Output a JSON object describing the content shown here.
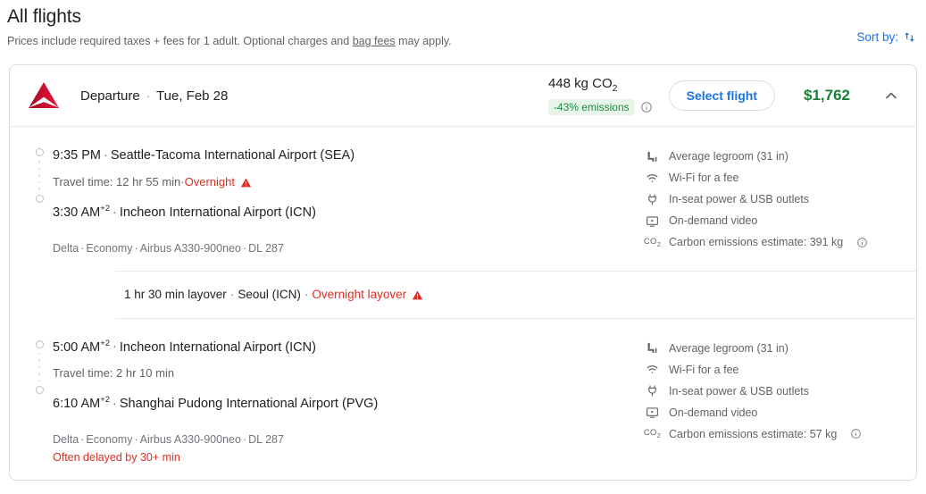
{
  "header": {
    "title": "All flights",
    "subtitle_pre": "Prices include required taxes + fees for 1 adult. Optional charges and ",
    "subtitle_link": "bag fees",
    "subtitle_post": " may apply.",
    "sort_label": "Sort by:"
  },
  "flight": {
    "airline_logo": "delta-logo",
    "direction_label": "Departure",
    "separator": "·",
    "date": "Tue, Feb 28",
    "emissions_total": "448 kg CO",
    "emissions_total_sub": "2",
    "emissions_badge": "-43% emissions",
    "select_button": "Select flight",
    "price": "$1,762",
    "collapse_icon": "chevron-up-icon",
    "info_icon": "info-icon"
  },
  "legs": [
    {
      "depart_time": "9:35 PM",
      "depart_sup": "",
      "depart_airport": "Seattle-Tacoma International Airport (SEA)",
      "travel_time": "Travel time: 12 hr 55 min",
      "travel_separator": " · ",
      "warning": "Overnight",
      "warning_icon": "warning-triangle-icon",
      "arrive_time": "3:30 AM",
      "arrive_sup": "+2",
      "arrive_airport": "Incheon International Airport (ICN)",
      "meta": [
        "Delta",
        "Economy",
        "Airbus A330-900neo",
        "DL 287"
      ],
      "delay_note": "",
      "amenities": [
        {
          "icon": "legroom-icon",
          "text": "Average legroom (31 in)",
          "info": false
        },
        {
          "icon": "wifi-icon",
          "text": "Wi-Fi for a fee",
          "info": false
        },
        {
          "icon": "power-plug-icon",
          "text": "In-seat power & USB outlets",
          "info": false
        },
        {
          "icon": "video-icon",
          "text": "On-demand video",
          "info": false
        },
        {
          "icon": "co2-icon",
          "text": "Carbon emissions estimate: 391 kg",
          "info": true
        }
      ]
    },
    {
      "depart_time": "5:00 AM",
      "depart_sup": "+2",
      "depart_airport": "Incheon International Airport (ICN)",
      "travel_time": "Travel time: 2 hr 10 min",
      "travel_separator": "",
      "warning": "",
      "warning_icon": "",
      "arrive_time": "6:10 AM",
      "arrive_sup": "+2",
      "arrive_airport": "Shanghai Pudong International Airport (PVG)",
      "meta": [
        "Delta",
        "Economy",
        "Airbus A330-900neo",
        "DL 287"
      ],
      "delay_note": "Often delayed by 30+ min",
      "amenities": [
        {
          "icon": "legroom-icon",
          "text": "Average legroom (31 in)",
          "info": false
        },
        {
          "icon": "wifi-icon",
          "text": "Wi-Fi for a fee",
          "info": false
        },
        {
          "icon": "power-plug-icon",
          "text": "In-seat power & USB outlets",
          "info": false
        },
        {
          "icon": "video-icon",
          "text": "On-demand video",
          "info": false
        },
        {
          "icon": "co2-icon",
          "text": "Carbon emissions estimate: 57 kg",
          "info": true
        }
      ]
    }
  ],
  "layover": {
    "duration": "1 hr 30 min layover",
    "separator": "·",
    "city": "Seoul (ICN)",
    "warning": "Overnight layover",
    "warning_icon": "warning-triangle-icon"
  },
  "colors": {
    "accent_blue": "#1a73e8",
    "price_green": "#188038",
    "badge_green_bg": "#e6f4ea",
    "badge_green_fg": "#1e8e3e",
    "warning_red": "#d93025",
    "delta_red": "#c8102e"
  }
}
